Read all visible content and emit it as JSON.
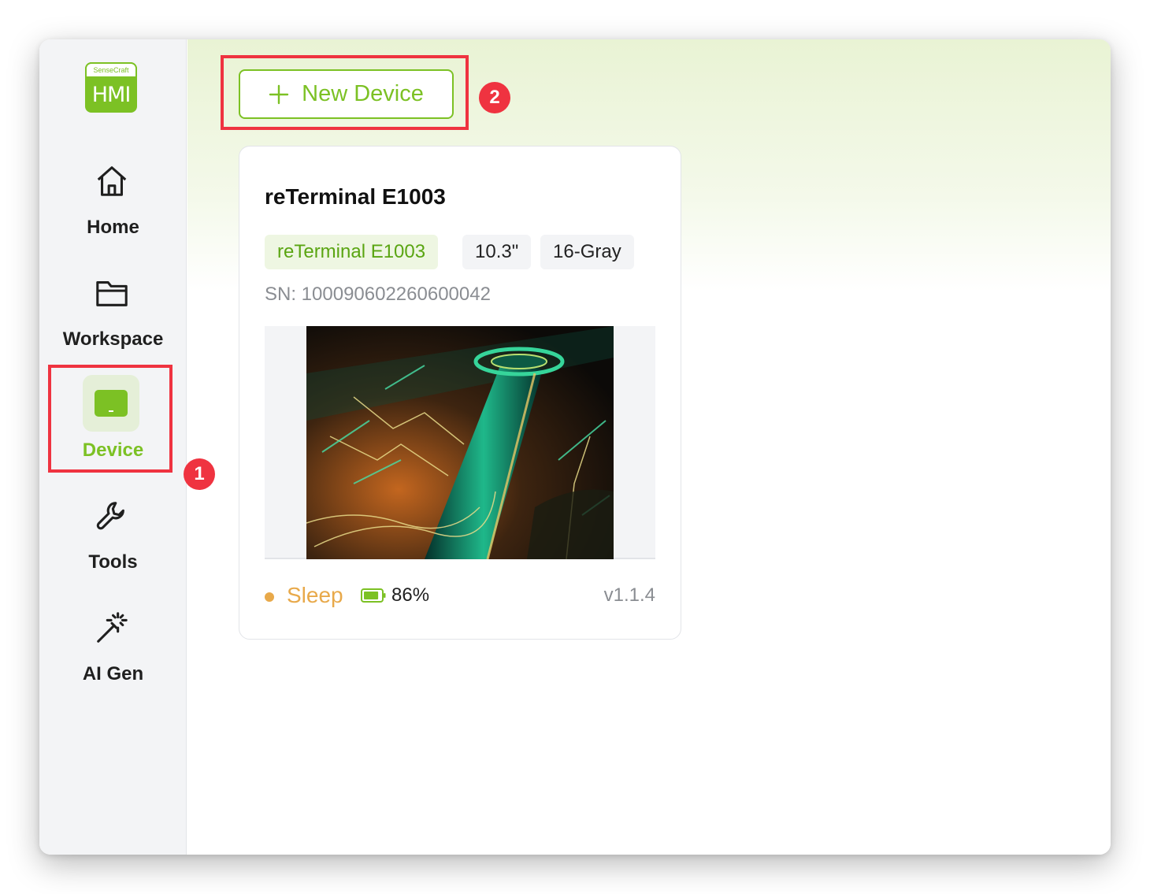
{
  "logo": {
    "brand": "SenseCraft",
    "product": "HMI"
  },
  "sidebar": {
    "items": [
      {
        "label": "Home",
        "icon": "home-icon"
      },
      {
        "label": "Workspace",
        "icon": "folder-icon"
      },
      {
        "label": "Device",
        "icon": "device-icon",
        "active": true
      },
      {
        "label": "Tools",
        "icon": "wrench-icon"
      },
      {
        "label": "AI Gen",
        "icon": "magic-wand-icon"
      }
    ]
  },
  "toolbar": {
    "new_device_label": "New Device",
    "new_device_icon": "plus-icon"
  },
  "device_card": {
    "title": "reTerminal E1003",
    "tags": [
      "reTerminal E1003",
      "10.3\"",
      "16-Gray"
    ],
    "sn": "SN: 100090602260600042",
    "status": "Sleep",
    "status_color": "#e8a94a",
    "battery": "86%",
    "battery_level": 0.86,
    "version": "v1.1.4"
  },
  "annotations": {
    "badge_1": "1",
    "badge_2": "2",
    "highlight_color": "#ef3340"
  },
  "colors": {
    "accent": "#7cc124",
    "sidebar_bg": "#f3f4f6"
  }
}
